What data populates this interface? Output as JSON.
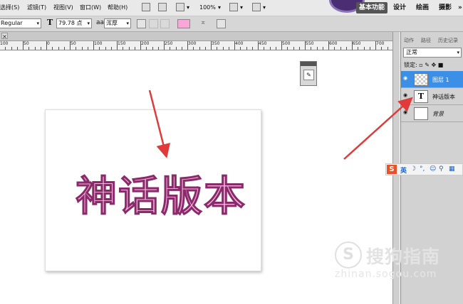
{
  "menubar": {
    "items": [
      "选择(S)",
      "滤镜(T)",
      "视图(V)",
      "窗口(W)",
      "帮助(H)"
    ],
    "zoom": "100%",
    "workspaces": [
      "基本功能",
      "设计",
      "绘画",
      "摄影"
    ],
    "overflow": "»"
  },
  "options": {
    "font_style": "Regular",
    "font_size": "79.78 点",
    "aa_label": "aa",
    "aa_mode": "浑厚",
    "text_color": "#f7a8d8"
  },
  "document": {
    "text": "神话版本"
  },
  "ruler": {
    "labels": [
      "100",
      "50",
      "0",
      "50",
      "100",
      "150",
      "200",
      "250",
      "300",
      "350",
      "400",
      "450",
      "500",
      "550",
      "600",
      "650",
      "700"
    ]
  },
  "layers_panel": {
    "tabs": [
      "动作",
      "路径",
      "历史记录"
    ],
    "blend_mode": "正常",
    "lock_label": "锁定:",
    "layers": [
      {
        "name": "图层 1",
        "selected": true,
        "thumb": "transparent"
      },
      {
        "name": "神话版本",
        "selected": false,
        "thumb": "text",
        "glyph": "T"
      },
      {
        "name": "背景",
        "selected": false,
        "thumb": "white"
      }
    ]
  },
  "ime": {
    "logo": "S",
    "lang": "英"
  },
  "watermark": {
    "logo": "S",
    "text": "搜狗指南",
    "sub": "zhinan.sogou.com"
  },
  "colors": {
    "selection": "#3b8fe6",
    "arrow": "#e03a3a",
    "text_fill": "#f5b6dc"
  }
}
